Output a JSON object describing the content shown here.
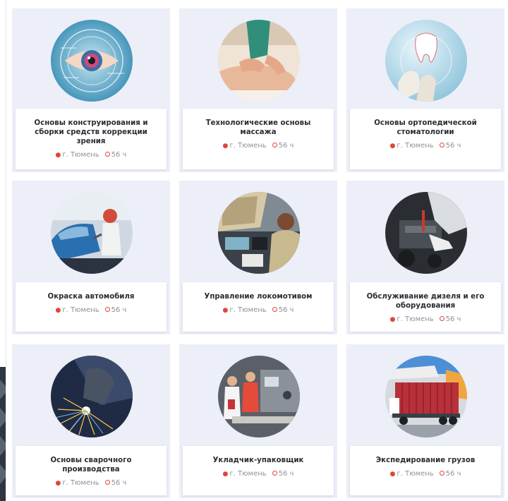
{
  "courses": [
    {
      "title": "Основы конструирования и сборки средств коррекции зрения",
      "city": "г. Тюмень",
      "hours": "56 ч",
      "image": "eye-tech"
    },
    {
      "title": "Технологические основы массажа",
      "city": "г. Тюмень",
      "hours": "56 ч",
      "image": "massage"
    },
    {
      "title": "Основы ортопедической стоматологии",
      "city": "г. Тюмень",
      "hours": "56 ч",
      "image": "dental"
    },
    {
      "title": "Окраска автомобиля",
      "city": "г. Тюмень",
      "hours": "56 ч",
      "image": "car-painting"
    },
    {
      "title": "Управление локомотивом",
      "city": "г. Тюмень",
      "hours": "56 ч",
      "image": "locomotive-cab"
    },
    {
      "title": "Обслуживание дизеля и его оборудования",
      "city": "г. Тюмень",
      "hours": "56 ч",
      "image": "engine"
    },
    {
      "title": "Основы сварочного производства",
      "city": "г. Тюмень",
      "hours": "56 ч",
      "image": "welding"
    },
    {
      "title": "Укладчик-упаковщик",
      "city": "г. Тюмень",
      "hours": "56 ч",
      "image": "packing-line"
    },
    {
      "title": "Экспедирование грузов",
      "city": "г. Тюмень",
      "hours": "56 ч",
      "image": "cargo-truck"
    }
  ],
  "colors": {
    "card_bg": "#eceef8",
    "accent": "#e0453a",
    "title": "#2a2d33",
    "meta": "#8d929b"
  }
}
